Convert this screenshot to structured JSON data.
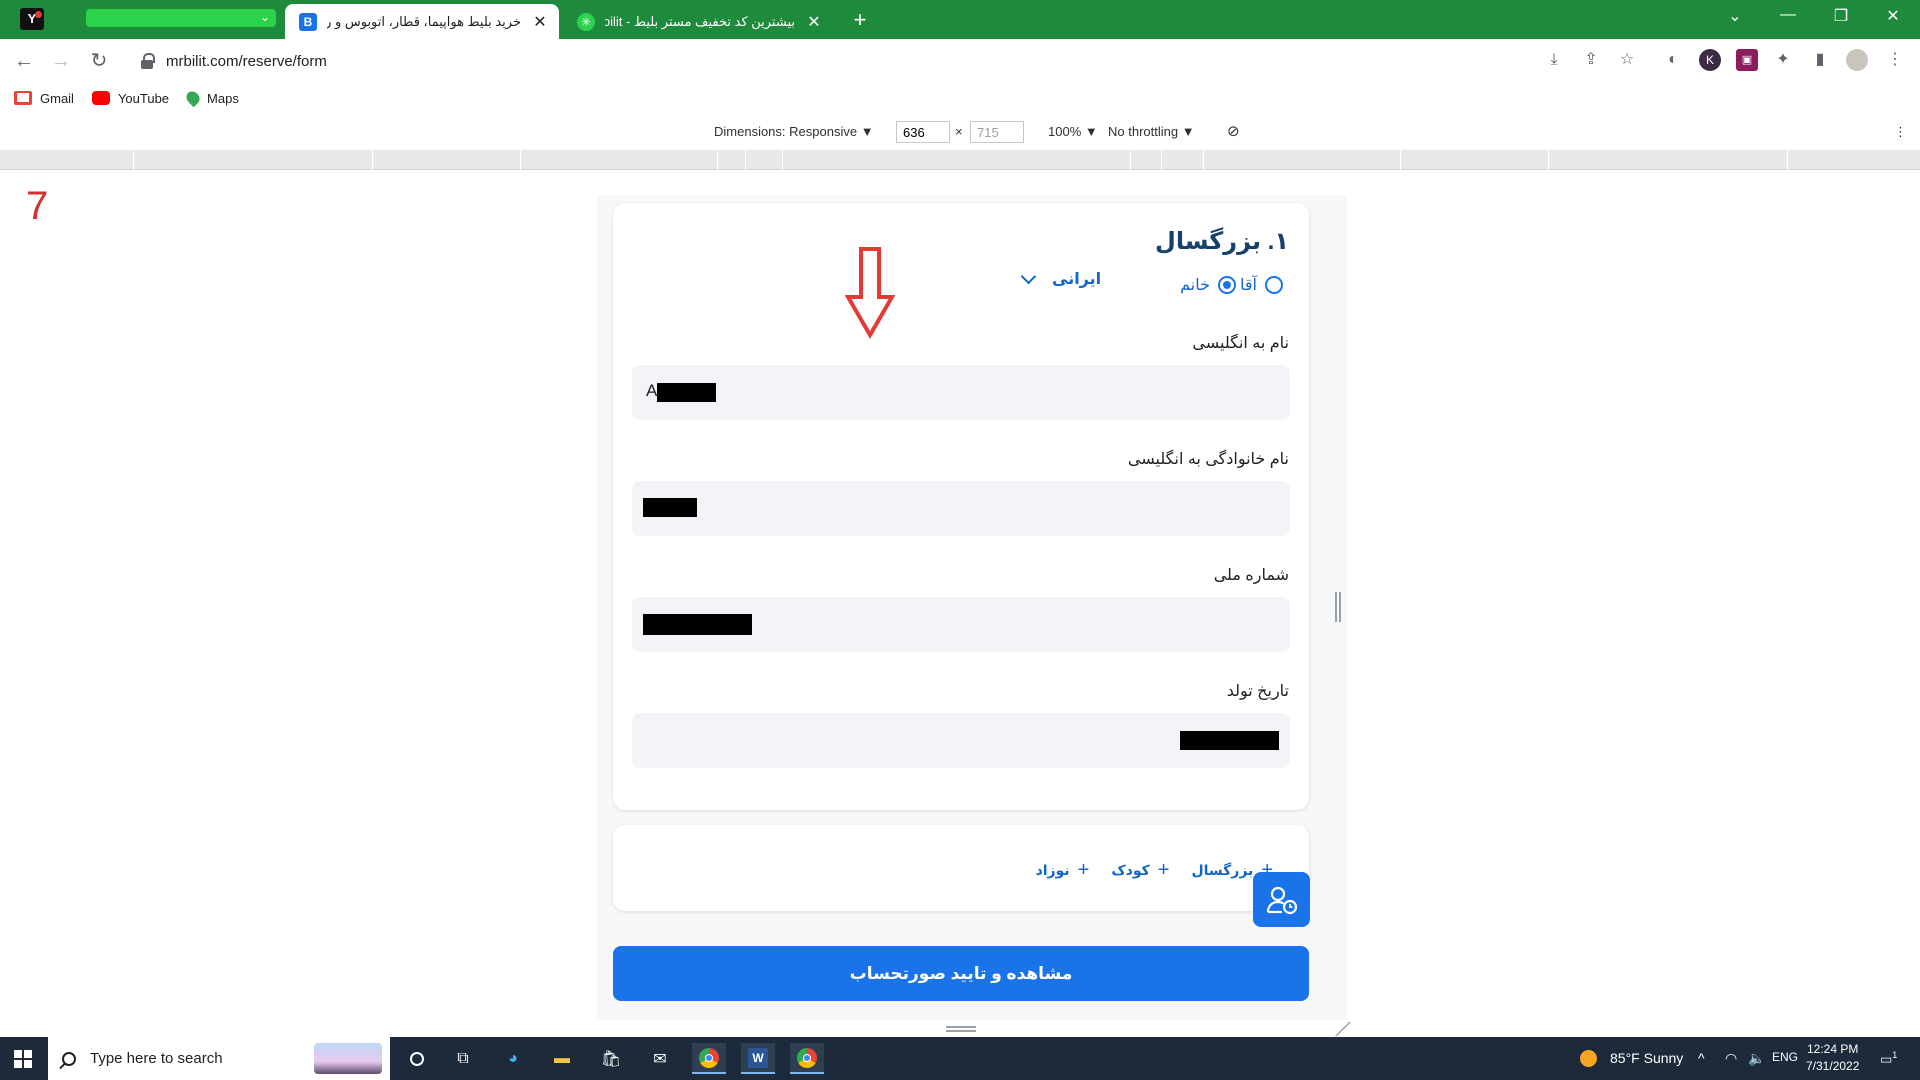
{
  "browser": {
    "tabs": [
      {
        "title": "خرید بلیط هواپیما، قطار، اتوبوس و رزر...",
        "favicon_letter": "B",
        "active": true
      },
      {
        "title": "بیشترین کد تخفیف مستر بلیط - mrbilit",
        "active": false
      }
    ],
    "url": "mrbilit.com/reserve/form",
    "bookmarks": [
      {
        "label": "Gmail",
        "icon": "gmail-icon",
        "color": "#ea4335"
      },
      {
        "label": "YouTube",
        "icon": "youtube-icon",
        "color": "#ff0000"
      },
      {
        "label": "Maps",
        "icon": "maps-icon",
        "color": "#34a853"
      }
    ],
    "tab_strip_color": "#1e8a3c",
    "profile_initial": "K"
  },
  "device_toolbar": {
    "dimensions_label": "Dimensions: Responsive",
    "width": "636",
    "times": "×",
    "height": "715",
    "zoom": "100%",
    "throttling": "No throttling"
  },
  "annotation": {
    "step_number": "7",
    "arrow_color": "#e53935"
  },
  "form": {
    "passenger_title": "۱. بزرگسال",
    "gender_male": "آقا",
    "gender_female": "خانم",
    "selected_gender": "female",
    "nationality": "ایرانی",
    "fields": {
      "first_name_label": "نام به انگلیسی",
      "first_name_value_prefix": "A",
      "last_name_label": "نام خانوادگی به انگلیسی",
      "national_id_label": "شماره ملی",
      "birth_date_label": "تاریخ تولد"
    },
    "add_passenger": {
      "adult": "بزرگسال",
      "child": "کودک",
      "infant": "نوزاد"
    },
    "confirm_button": "مشاهده و تایید صورتحساب",
    "accent_color": "#1a73e8"
  },
  "taskbar": {
    "search_placeholder": "Type here to search",
    "weather": "85°F  Sunny",
    "language": "ENG",
    "time": "12:24 PM",
    "date": "7/31/2022",
    "notification_count": "1"
  }
}
